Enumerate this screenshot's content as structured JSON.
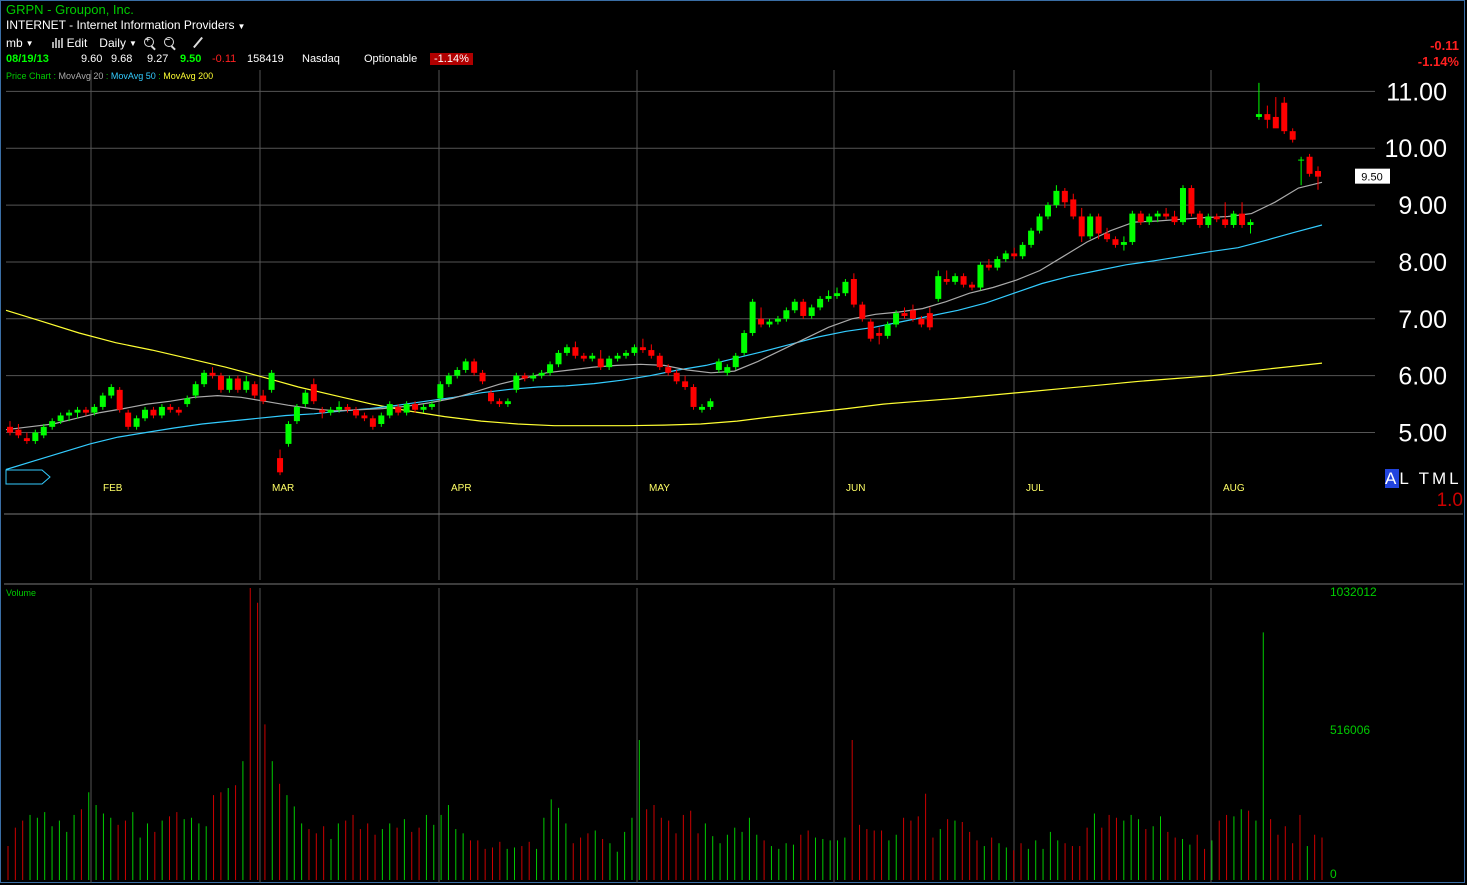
{
  "header": {
    "symbol_line": "GRPN - Groupon, Inc.",
    "industry_line": "INTERNET - Internet Information Providers",
    "toolbar": {
      "layout_label": "mb",
      "edit_label": "Edit",
      "period_label": "Daily"
    },
    "quote": {
      "date": "08/19/13",
      "open": "9.60",
      "high": "9.68",
      "low": "9.27",
      "last": "9.50",
      "change": "-0.11",
      "volume": "158419",
      "exchange": "Nasdaq",
      "optionable": "Optionable",
      "change_pct": "-1.14%"
    },
    "legend": {
      "label": "Price Chart :",
      "ma20": "MovAvg 20",
      "ma50": "MovAvg 50",
      "ma200": "MovAvg 200"
    },
    "right_change": "-0.11",
    "right_change_pct": "-1.14%"
  },
  "colors": {
    "up": "#00ff00",
    "down": "#ff0000",
    "ma20": "#aaaaaa",
    "ma50": "#33ccff",
    "ma200": "#ffff33",
    "grid": "#555555",
    "vol_up": "#00cc00",
    "vol_down": "#cc0000"
  },
  "price_tag": "9.50",
  "altml": {
    "letters": [
      "A",
      "L",
      "T",
      "M",
      "L"
    ],
    "value": "1.0"
  },
  "chart_data": [
    {
      "type": "candlestick",
      "title": "Price Chart",
      "y_ticks": [
        "11.00",
        "10.00",
        "9.00",
        "8.00",
        "7.00",
        "6.00",
        "5.00"
      ],
      "x_ticks": [
        {
          "label": "FEB",
          "index": 14
        },
        {
          "label": "MAR",
          "index": 32
        },
        {
          "label": "APR",
          "index": 52
        },
        {
          "label": "MAY",
          "index": 73
        },
        {
          "label": "JUN",
          "index": 94
        },
        {
          "label": "JUL",
          "index": 113
        },
        {
          "label": "AUG",
          "index": 134
        }
      ],
      "ylim": [
        4.2,
        11.2
      ],
      "ohlc": [
        [
          5.1,
          5.2,
          4.95,
          5.0
        ],
        [
          5.05,
          5.15,
          4.9,
          4.95
        ],
        [
          4.9,
          5.0,
          4.8,
          4.85
        ],
        [
          4.85,
          5.05,
          4.8,
          5.0
        ],
        [
          4.95,
          5.15,
          4.9,
          5.1
        ],
        [
          5.1,
          5.25,
          5.05,
          5.2
        ],
        [
          5.2,
          5.35,
          5.15,
          5.3
        ],
        [
          5.3,
          5.4,
          5.2,
          5.35
        ],
        [
          5.35,
          5.45,
          5.25,
          5.4
        ],
        [
          5.4,
          5.45,
          5.3,
          5.35
        ],
        [
          5.35,
          5.5,
          5.3,
          5.45
        ],
        [
          5.45,
          5.7,
          5.4,
          5.65
        ],
        [
          5.65,
          5.85,
          5.6,
          5.8
        ],
        [
          5.75,
          5.8,
          5.35,
          5.4
        ],
        [
          5.35,
          5.4,
          5.05,
          5.1
        ],
        [
          5.1,
          5.3,
          5.05,
          5.25
        ],
        [
          5.25,
          5.45,
          5.2,
          5.4
        ],
        [
          5.4,
          5.45,
          5.25,
          5.3
        ],
        [
          5.3,
          5.5,
          5.25,
          5.45
        ],
        [
          5.45,
          5.5,
          5.35,
          5.4
        ],
        [
          5.4,
          5.45,
          5.3,
          5.35
        ],
        [
          5.5,
          5.65,
          5.45,
          5.6
        ],
        [
          5.65,
          5.9,
          5.6,
          5.85
        ],
        [
          5.85,
          6.1,
          5.8,
          6.05
        ],
        [
          6.05,
          6.15,
          5.95,
          6.0
        ],
        [
          6.0,
          6.05,
          5.7,
          5.75
        ],
        [
          5.75,
          6.0,
          5.7,
          5.95
        ],
        [
          5.95,
          6.0,
          5.7,
          5.75
        ],
        [
          5.75,
          6.0,
          5.7,
          5.9
        ],
        [
          5.85,
          5.9,
          5.6,
          5.65
        ],
        [
          5.65,
          5.75,
          5.5,
          5.55
        ],
        [
          5.75,
          6.1,
          5.7,
          6.05
        ],
        [
          4.55,
          4.7,
          4.25,
          4.3
        ],
        [
          4.8,
          5.2,
          4.75,
          5.15
        ],
        [
          5.2,
          5.5,
          5.15,
          5.45
        ],
        [
          5.5,
          5.75,
          5.45,
          5.7
        ],
        [
          5.85,
          5.95,
          5.5,
          5.55
        ],
        [
          5.4,
          5.45,
          5.25,
          5.35
        ],
        [
          5.35,
          5.45,
          5.3,
          5.4
        ],
        [
          5.4,
          5.55,
          5.35,
          5.45
        ],
        [
          5.45,
          5.5,
          5.35,
          5.4
        ],
        [
          5.4,
          5.45,
          5.25,
          5.3
        ],
        [
          5.3,
          5.35,
          5.2,
          5.25
        ],
        [
          5.25,
          5.3,
          5.05,
          5.1
        ],
        [
          5.15,
          5.35,
          5.1,
          5.3
        ],
        [
          5.3,
          5.55,
          5.25,
          5.5
        ],
        [
          5.45,
          5.5,
          5.3,
          5.35
        ],
        [
          5.35,
          5.55,
          5.3,
          5.5
        ],
        [
          5.5,
          5.55,
          5.35,
          5.4
        ],
        [
          5.4,
          5.5,
          5.35,
          5.45
        ],
        [
          5.45,
          5.55,
          5.4,
          5.5
        ],
        [
          5.6,
          5.9,
          5.55,
          5.85
        ],
        [
          5.85,
          6.05,
          5.8,
          6.0
        ],
        [
          6.0,
          6.15,
          5.95,
          6.1
        ],
        [
          6.1,
          6.3,
          6.05,
          6.25
        ],
        [
          6.25,
          6.3,
          6.0,
          6.05
        ],
        [
          6.05,
          6.1,
          5.85,
          5.9
        ],
        [
          5.7,
          5.75,
          5.5,
          5.55
        ],
        [
          5.55,
          5.6,
          5.45,
          5.5
        ],
        [
          5.5,
          5.6,
          5.45,
          5.55
        ],
        [
          5.75,
          6.05,
          5.7,
          6.0
        ],
        [
          6.0,
          6.05,
          5.9,
          5.95
        ],
        [
          5.95,
          6.05,
          5.9,
          6.0
        ],
        [
          6.0,
          6.1,
          5.95,
          6.05
        ],
        [
          6.05,
          6.25,
          6.0,
          6.2
        ],
        [
          6.2,
          6.45,
          6.15,
          6.4
        ],
        [
          6.4,
          6.55,
          6.35,
          6.5
        ],
        [
          6.5,
          6.6,
          6.3,
          6.35
        ],
        [
          6.35,
          6.4,
          6.25,
          6.3
        ],
        [
          6.3,
          6.4,
          6.25,
          6.35
        ],
        [
          6.3,
          6.45,
          6.1,
          6.15
        ],
        [
          6.15,
          6.35,
          6.1,
          6.3
        ],
        [
          6.3,
          6.4,
          6.25,
          6.35
        ],
        [
          6.35,
          6.45,
          6.3,
          6.4
        ],
        [
          6.4,
          6.55,
          6.35,
          6.5
        ],
        [
          6.5,
          6.65,
          6.4,
          6.45
        ],
        [
          6.45,
          6.55,
          6.3,
          6.35
        ],
        [
          6.35,
          6.4,
          6.1,
          6.15
        ],
        [
          6.15,
          6.2,
          6.0,
          6.05
        ],
        [
          6.05,
          6.1,
          5.85,
          5.9
        ],
        [
          5.9,
          6.0,
          5.75,
          5.8
        ],
        [
          5.8,
          5.85,
          5.4,
          5.45
        ],
        [
          5.4,
          5.5,
          5.35,
          5.45
        ],
        [
          5.45,
          5.6,
          5.4,
          5.55
        ],
        [
          6.1,
          6.3,
          6.05,
          6.25
        ],
        [
          6.05,
          6.2,
          6.0,
          6.15
        ],
        [
          6.15,
          6.4,
          6.1,
          6.35
        ],
        [
          6.4,
          6.8,
          6.35,
          6.75
        ],
        [
          6.75,
          7.35,
          6.7,
          7.3
        ],
        [
          7.0,
          7.2,
          6.85,
          6.9
        ],
        [
          6.9,
          7.0,
          6.85,
          6.95
        ],
        [
          6.95,
          7.05,
          6.9,
          7.0
        ],
        [
          7.0,
          7.2,
          6.95,
          7.15
        ],
        [
          7.15,
          7.35,
          7.1,
          7.3
        ],
        [
          7.3,
          7.35,
          7.0,
          7.05
        ],
        [
          7.05,
          7.25,
          7.0,
          7.2
        ],
        [
          7.2,
          7.4,
          7.15,
          7.35
        ],
        [
          7.35,
          7.5,
          7.3,
          7.4
        ],
        [
          7.4,
          7.55,
          7.35,
          7.45
        ],
        [
          7.45,
          7.7,
          7.4,
          7.65
        ],
        [
          7.7,
          7.8,
          7.2,
          7.25
        ],
        [
          7.25,
          7.3,
          6.95,
          7.0
        ],
        [
          6.95,
          7.0,
          6.6,
          6.65
        ],
        [
          6.75,
          6.85,
          6.55,
          6.7
        ],
        [
          6.7,
          6.95,
          6.65,
          6.9
        ],
        [
          6.9,
          7.15,
          6.85,
          7.1
        ],
        [
          7.1,
          7.2,
          7.0,
          7.05
        ],
        [
          7.15,
          7.25,
          6.95,
          7.0
        ],
        [
          7.0,
          7.05,
          6.85,
          6.9
        ],
        [
          7.1,
          7.2,
          6.8,
          6.85
        ],
        [
          7.35,
          7.85,
          7.3,
          7.75
        ],
        [
          7.7,
          7.85,
          7.6,
          7.65
        ],
        [
          7.65,
          7.8,
          7.6,
          7.75
        ],
        [
          7.75,
          7.8,
          7.55,
          7.6
        ],
        [
          7.6,
          7.65,
          7.5,
          7.55
        ],
        [
          7.55,
          8.0,
          7.5,
          7.95
        ],
        [
          7.95,
          8.05,
          7.85,
          7.9
        ],
        [
          7.9,
          8.1,
          7.85,
          8.05
        ],
        [
          8.05,
          8.2,
          8.0,
          8.15
        ],
        [
          8.15,
          8.25,
          8.05,
          8.1
        ],
        [
          8.1,
          8.35,
          8.05,
          8.3
        ],
        [
          8.3,
          8.6,
          8.25,
          8.55
        ],
        [
          8.55,
          8.85,
          8.5,
          8.8
        ],
        [
          8.8,
          9.05,
          8.75,
          9.0
        ],
        [
          9.0,
          9.35,
          8.95,
          9.25
        ],
        [
          9.25,
          9.3,
          8.95,
          9.05
        ],
        [
          9.1,
          9.2,
          8.75,
          8.8
        ],
        [
          8.8,
          8.95,
          8.35,
          8.45
        ],
        [
          8.45,
          8.85,
          8.4,
          8.8
        ],
        [
          8.8,
          8.85,
          8.4,
          8.5
        ],
        [
          8.5,
          8.6,
          8.35,
          8.4
        ],
        [
          8.4,
          8.45,
          8.25,
          8.3
        ],
        [
          8.3,
          8.45,
          8.2,
          8.35
        ],
        [
          8.35,
          8.9,
          8.3,
          8.85
        ],
        [
          8.85,
          8.9,
          8.65,
          8.7
        ],
        [
          8.7,
          8.85,
          8.65,
          8.8
        ],
        [
          8.8,
          8.9,
          8.7,
          8.85
        ],
        [
          8.85,
          8.95,
          8.75,
          8.8
        ],
        [
          8.8,
          8.9,
          8.65,
          8.7
        ],
        [
          8.7,
          9.35,
          8.65,
          9.3
        ],
        [
          9.3,
          9.35,
          8.8,
          8.85
        ],
        [
          8.85,
          8.9,
          8.6,
          8.65
        ],
        [
          8.65,
          8.85,
          8.6,
          8.8
        ],
        [
          8.8,
          8.85,
          8.7,
          8.75
        ],
        [
          8.75,
          9.05,
          8.6,
          8.65
        ],
        [
          8.65,
          8.9,
          8.6,
          8.85
        ],
        [
          8.85,
          9.05,
          8.6,
          8.65
        ],
        [
          8.65,
          8.75,
          8.5,
          8.7
        ],
        [
          10.55,
          11.15,
          10.5,
          10.6
        ],
        [
          10.6,
          10.75,
          10.35,
          10.5
        ],
        [
          10.55,
          10.9,
          10.4,
          10.35
        ],
        [
          10.8,
          10.9,
          10.25,
          10.3
        ],
        [
          10.3,
          10.35,
          10.1,
          10.15
        ],
        [
          9.8,
          9.85,
          9.35,
          9.8
        ],
        [
          9.85,
          9.9,
          9.5,
          9.55
        ],
        [
          9.6,
          9.68,
          9.27,
          9.5
        ]
      ],
      "ma20": [
        5.05,
        5.1,
        5.15,
        5.25,
        5.35,
        5.42,
        5.5,
        5.55,
        5.62,
        5.65,
        5.62,
        5.55,
        5.48,
        5.42,
        5.38,
        5.4,
        5.42,
        5.46,
        5.52,
        5.6,
        5.72,
        5.85,
        5.95,
        6.05,
        6.1,
        6.15,
        6.18,
        6.2,
        6.18,
        6.1,
        6.05,
        6.08,
        6.25,
        6.45,
        6.65,
        6.85,
        7.0,
        7.08,
        7.12,
        7.18,
        7.3,
        7.45,
        7.55,
        7.68,
        7.85,
        8.1,
        8.35,
        8.55,
        8.7,
        8.72,
        8.75,
        8.78,
        8.8,
        8.85,
        9.05,
        9.3,
        9.4
      ],
      "ma50": [
        4.35,
        4.5,
        4.65,
        4.8,
        4.92,
        5.0,
        5.08,
        5.15,
        5.2,
        5.25,
        5.3,
        5.33,
        5.38,
        5.42,
        5.48,
        5.55,
        5.62,
        5.7,
        5.76,
        5.8,
        5.82,
        5.86,
        5.92,
        6.0,
        6.1,
        6.18,
        6.3,
        6.42,
        6.55,
        6.68,
        6.78,
        6.85,
        6.95,
        7.05,
        7.15,
        7.28,
        7.45,
        7.62,
        7.75,
        7.85,
        7.95,
        8.02,
        8.1,
        8.18,
        8.25,
        8.38,
        8.52,
        8.65
      ],
      "ma200": [
        7.15,
        6.95,
        6.75,
        6.58,
        6.45,
        6.3,
        6.15,
        5.98,
        5.8,
        5.65,
        5.5,
        5.38,
        5.28,
        5.2,
        5.15,
        5.12,
        5.12,
        5.12,
        5.13,
        5.15,
        5.2,
        5.28,
        5.35,
        5.42,
        5.5,
        5.55,
        5.6,
        5.66,
        5.72,
        5.78,
        5.84,
        5.9,
        5.95,
        6.0,
        6.08,
        6.15,
        6.22
      ]
    },
    {
      "type": "bar",
      "title": "Volume",
      "y_ticks": [
        "1032012",
        "516006",
        "0"
      ],
      "ylim": [
        0,
        1032012
      ],
      "values": [
        120000,
        185000,
        210000,
        230000,
        220000,
        240000,
        190000,
        210000,
        170000,
        230000,
        250000,
        310000,
        265000,
        235000,
        220000,
        195000,
        210000,
        240000,
        150000,
        200000,
        170000,
        210000,
        225000,
        240000,
        215000,
        220000,
        200000,
        190000,
        300000,
        310000,
        325000,
        335000,
        420000,
        1032012,
        980000,
        550000,
        420000,
        340000,
        300000,
        260000,
        200000,
        180000,
        165000,
        190000,
        145000,
        200000,
        210000,
        230000,
        180000,
        200000,
        160000,
        180000,
        200000,
        185000,
        215000,
        170000,
        185000,
        230000,
        195000,
        230000,
        265000,
        180000,
        165000,
        140000,
        140000,
        110000,
        115000,
        135000,
        110000,
        115000,
        120000,
        135000,
        110000,
        220000,
        285000,
        255000,
        200000,
        130000,
        150000,
        165000,
        175000,
        145000,
        130000,
        100000,
        170000,
        220000,
        495000,
        250000,
        265000,
        220000,
        210000,
        165000,
        230000,
        245000,
        165000,
        200000,
        155000,
        130000,
        160000,
        185000,
        170000,
        220000,
        160000,
        140000,
        120000,
        110000,
        130000,
        125000,
        160000,
        175000,
        150000,
        145000,
        140000,
        140000,
        150000,
        495000,
        195000,
        180000,
        175000,
        175000,
        140000,
        160000,
        220000,
        210000,
        225000,
        305000,
        150000,
        180000,
        215000,
        210000,
        205000,
        170000,
        140000,
        120000,
        150000,
        130000,
        115000,
        105000,
        130000,
        110000,
        140000,
        110000,
        170000,
        140000,
        130000,
        120000,
        120000,
        185000,
        235000,
        185000,
        230000,
        220000,
        210000,
        230000,
        215000,
        180000,
        190000,
        225000,
        170000,
        150000,
        145000,
        125000,
        160000,
        110000,
        140000,
        210000,
        230000,
        225000,
        250000,
        245000,
        210000,
        875000,
        215000,
        160000,
        190000,
        130000,
        230000,
        120000,
        160000,
        150000
      ]
    }
  ]
}
